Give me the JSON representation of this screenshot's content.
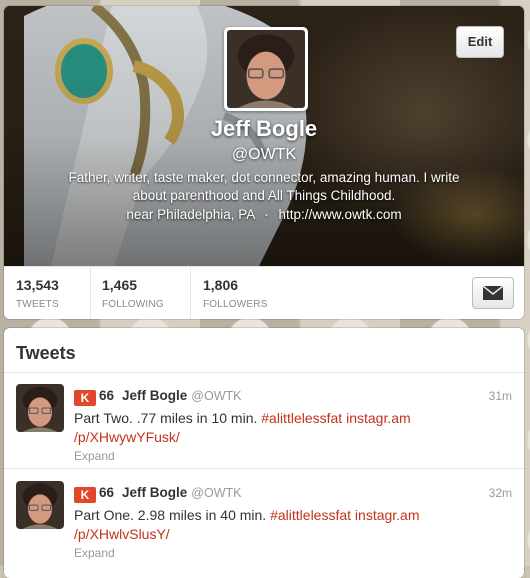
{
  "profile": {
    "name": "Jeff Bogle",
    "handle": "@OWTK",
    "bio": "Father, writer, taste maker, dot connector, amazing human. I write about parenthood and All Things Childhood.",
    "location": "near Philadelphia, PA",
    "separator": "·",
    "website": "http://www.owtk.com",
    "edit_label": "Edit"
  },
  "stats": [
    {
      "value": "13,543",
      "label": "TWEETS"
    },
    {
      "value": "1,465",
      "label": "FOLLOWING"
    },
    {
      "value": "1,806",
      "label": "FOLLOWERS"
    }
  ],
  "tweets_section": {
    "title": "Tweets",
    "items": [
      {
        "klout_icon": "K",
        "klout_score": "66",
        "name": "Jeff Bogle",
        "handle": "@OWTK",
        "time": "31m",
        "text_plain": "Part Two. .77 miles in 10 min.",
        "hashtag": "#alittlelessfat",
        "link_line1": "instagr.am",
        "link_line2": "/p/XHwywYFusk/",
        "expand": "Expand"
      },
      {
        "klout_icon": "K",
        "klout_score": "66",
        "name": "Jeff Bogle",
        "handle": "@OWTK",
        "time": "32m",
        "text_plain": "Part One. 2.98 miles in 40 min.",
        "hashtag": "#alittlelessfat",
        "link_line1": "instagr.am",
        "link_line2": "/p/XHwlvSlusY/",
        "expand": "Expand"
      }
    ]
  },
  "colors": {
    "link": "#c4321a",
    "klout": "#e0472b"
  },
  "icons": {
    "dm": "envelope-icon",
    "klout": "klout-icon"
  }
}
